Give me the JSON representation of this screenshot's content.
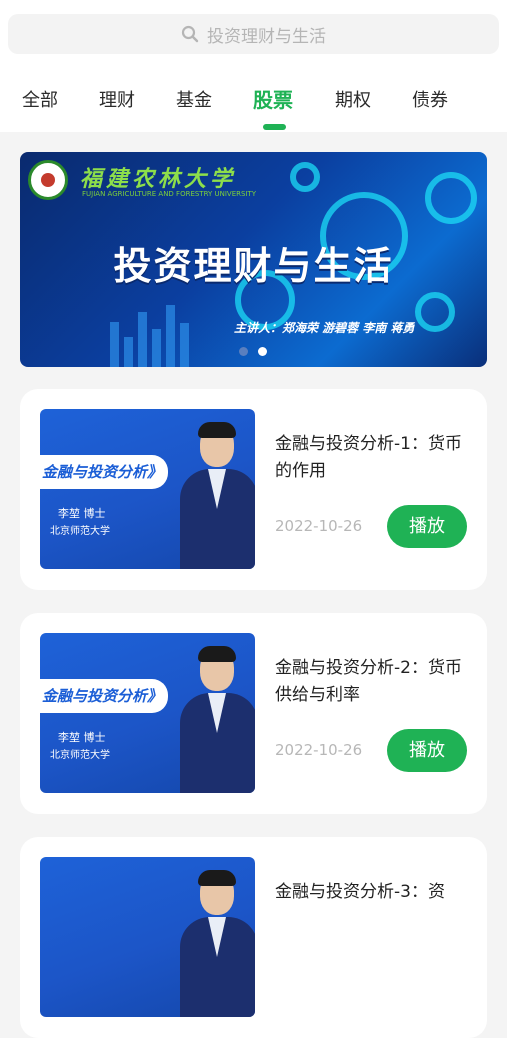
{
  "search": {
    "placeholder": "投资理财与生活"
  },
  "tabs": [
    {
      "label": "全部"
    },
    {
      "label": "理财"
    },
    {
      "label": "基金"
    },
    {
      "label": "股票",
      "active": true
    },
    {
      "label": "期权"
    },
    {
      "label": "债券"
    }
  ],
  "banner": {
    "title": "投资理财与生活",
    "speakers": "主讲人：郑海荣 游碧蓉 李南 蒋勇",
    "logo_text": "福建农林大学",
    "logo_en": "FUJIAN AGRICULTURE AND FORESTRY UNIVERSITY",
    "page_count": 2,
    "current_page": 2
  },
  "courses": [
    {
      "title": "金融与投资分析-1：货币的作用",
      "date": "2022-10-26",
      "play_label": "播放",
      "thumb_title": "金融与投资分析》",
      "thumb_name": "李堃 博士",
      "thumb_org": "北京师范大学"
    },
    {
      "title": "金融与投资分析-2：货币供给与利率",
      "date": "2022-10-26",
      "play_label": "播放",
      "thumb_title": "金融与投资分析》",
      "thumb_name": "李堃 博士",
      "thumb_org": "北京师范大学"
    },
    {
      "title": "金融与投资分析-3：资",
      "date": "",
      "play_label": "",
      "thumb_title": "",
      "thumb_name": "",
      "thumb_org": ""
    }
  ],
  "colors": {
    "accent": "#1fb255",
    "background": "#f4f4f4",
    "card": "#ffffff"
  }
}
